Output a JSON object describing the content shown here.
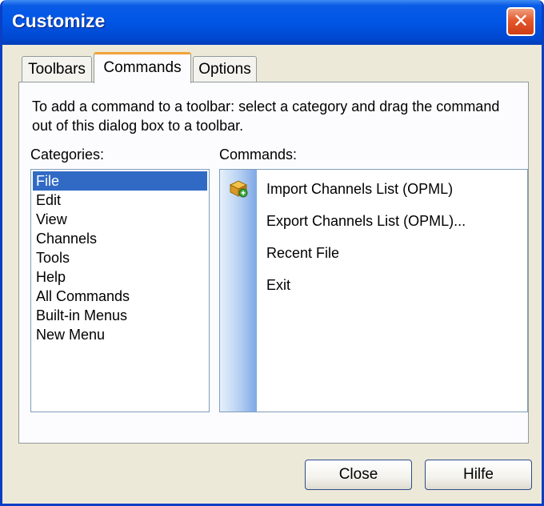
{
  "window": {
    "title": "Customize",
    "close_glyph": "✕"
  },
  "tabs": [
    {
      "label": "Toolbars",
      "active": false
    },
    {
      "label": "Commands",
      "active": true
    },
    {
      "label": "Options",
      "active": false
    }
  ],
  "commands_tab": {
    "instructions": "To add a command to a toolbar: select a category and drag the command out of this dialog box to a toolbar.",
    "categories_label": "Categories:",
    "commands_label": "Commands:",
    "categories": [
      "File",
      "Edit",
      "View",
      "Channels",
      "Tools",
      "Help",
      "All Commands",
      "Built-in Menus",
      "New Menu"
    ],
    "selected_category": "File",
    "commands": [
      {
        "label": "Import Channels List (OPML)",
        "icon": "import-icon"
      },
      {
        "label": "Export Channels List (OPML)...",
        "icon": ""
      },
      {
        "label": "Recent File",
        "icon": ""
      },
      {
        "label": "Exit",
        "icon": ""
      }
    ]
  },
  "buttons": {
    "close": "Close",
    "help": "Hilfe"
  }
}
